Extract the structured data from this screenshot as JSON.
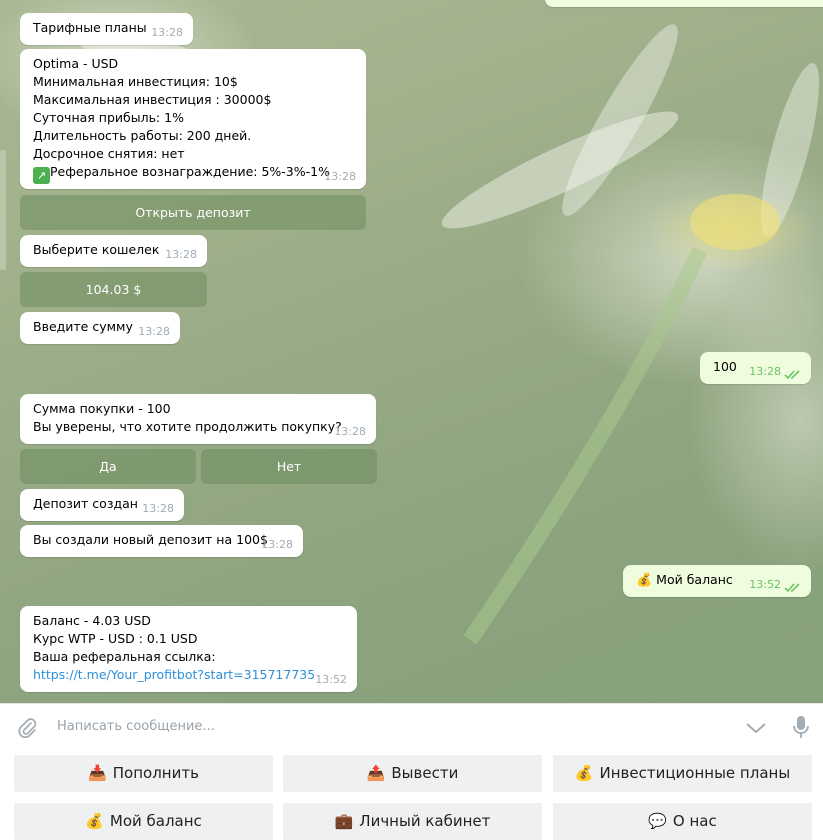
{
  "messages": {
    "m1": {
      "text": "Тарифные планы",
      "time": "13:28"
    },
    "m2": {
      "lines": [
        "Optima - USD",
        "Минимальная инвестиция: 10$",
        "Максимальная инвестиция : 30000$",
        "Суточная прибыль: 1%",
        "Длительность работы: 200 дней.",
        "Досрочное снятия: нет",
        "Реферальное вознаграждение: 5%-3%-1%"
      ],
      "time": "13:28"
    },
    "btn_open_deposit": "Открыть депозит",
    "m3": {
      "text": "Выберите кошелек",
      "time": "13:28"
    },
    "btn_wallet": "104.03 $",
    "m4": {
      "text": "Введите сумму",
      "time": "13:28"
    },
    "out1": {
      "text": "100",
      "time": "13:28"
    },
    "m5": {
      "lines": [
        "Сумма покупки - 100",
        "Вы уверены, что хотите продолжить покупку?"
      ],
      "time": "13:28"
    },
    "btn_yes": "Да",
    "btn_no": "Нет",
    "m6": {
      "text": "Депозит создан",
      "time": "13:28"
    },
    "m7": {
      "text": "Вы создали новый депозит на 100$",
      "time": "13:28"
    },
    "out2": {
      "text": "Мой баланс",
      "time": "13:52"
    },
    "m8": {
      "lines": [
        "Баланс - 4.03 USD",
        "Курс WTP - USD : 0.1 USD",
        "Ваша реферальная ссылка:"
      ],
      "link": "https://t.me/Your_profitbot?start=315717735",
      "time": "13:52"
    }
  },
  "input": {
    "placeholder": "Написать сообщение..."
  },
  "keyboard": {
    "row1": [
      {
        "label": "Пополнить",
        "icon": "inbox-tray-icon"
      },
      {
        "label": "Вывести",
        "icon": "outbox-tray-icon"
      },
      {
        "label": "Инвестиционные планы",
        "icon": "money-bag-icon"
      }
    ],
    "row2": [
      {
        "label": "Мой баланс",
        "icon": "money-bag-icon"
      },
      {
        "label": "Личный кабинет",
        "icon": "briefcase-icon"
      },
      {
        "label": "О нас",
        "icon": "speech-bubble-icon"
      }
    ]
  },
  "colors": {
    "outgoing_bubble": "#effdde",
    "link": "#2f8fd8",
    "inline_button": "#6e8c5f",
    "read_check": "#6dc262"
  }
}
